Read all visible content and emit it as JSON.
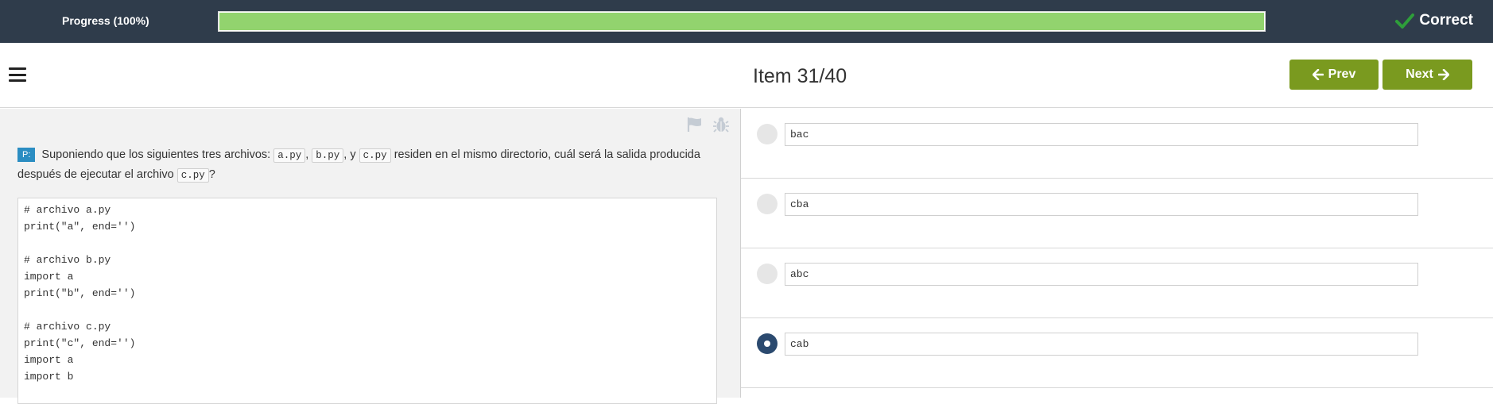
{
  "progress": {
    "label": "Progress (100%)",
    "percent": 100,
    "fill_color": "#92d36e"
  },
  "status": {
    "label": "Correct",
    "icon": "check-icon",
    "icon_color": "#2e9e3a"
  },
  "header": {
    "title": "Item 31/40",
    "prev_label": "Prev",
    "next_label": "Next",
    "prev_icon": "arrow-left-icon",
    "next_icon": "arrow-right-icon",
    "menu_icon": "hamburger-menu-icon",
    "button_color": "#7a9a1f"
  },
  "question": {
    "badge": "P:",
    "text_1": "Suponiendo que los siguientes tres archivos:",
    "file_a": "a.py",
    "sep_1": ",",
    "file_b": "b.py",
    "sep_2": ", y",
    "file_c": "c.py",
    "text_2": "residen en el mismo directorio, cuál será la salida producida después de ejecutar el archivo",
    "file_run": "c.py",
    "text_3": "?",
    "code": "# archivo a.py\nprint(\"a\", end='')\n\n# archivo b.py\nimport a\nprint(\"b\", end='')\n\n# archivo c.py\nprint(\"c\", end='')\nimport a\nimport b",
    "tools": [
      "flag-icon",
      "bug-icon"
    ]
  },
  "answers": [
    {
      "text": "bac",
      "selected": false
    },
    {
      "text": "cba",
      "selected": false
    },
    {
      "text": "abc",
      "selected": false
    },
    {
      "text": "cab",
      "selected": true
    }
  ]
}
